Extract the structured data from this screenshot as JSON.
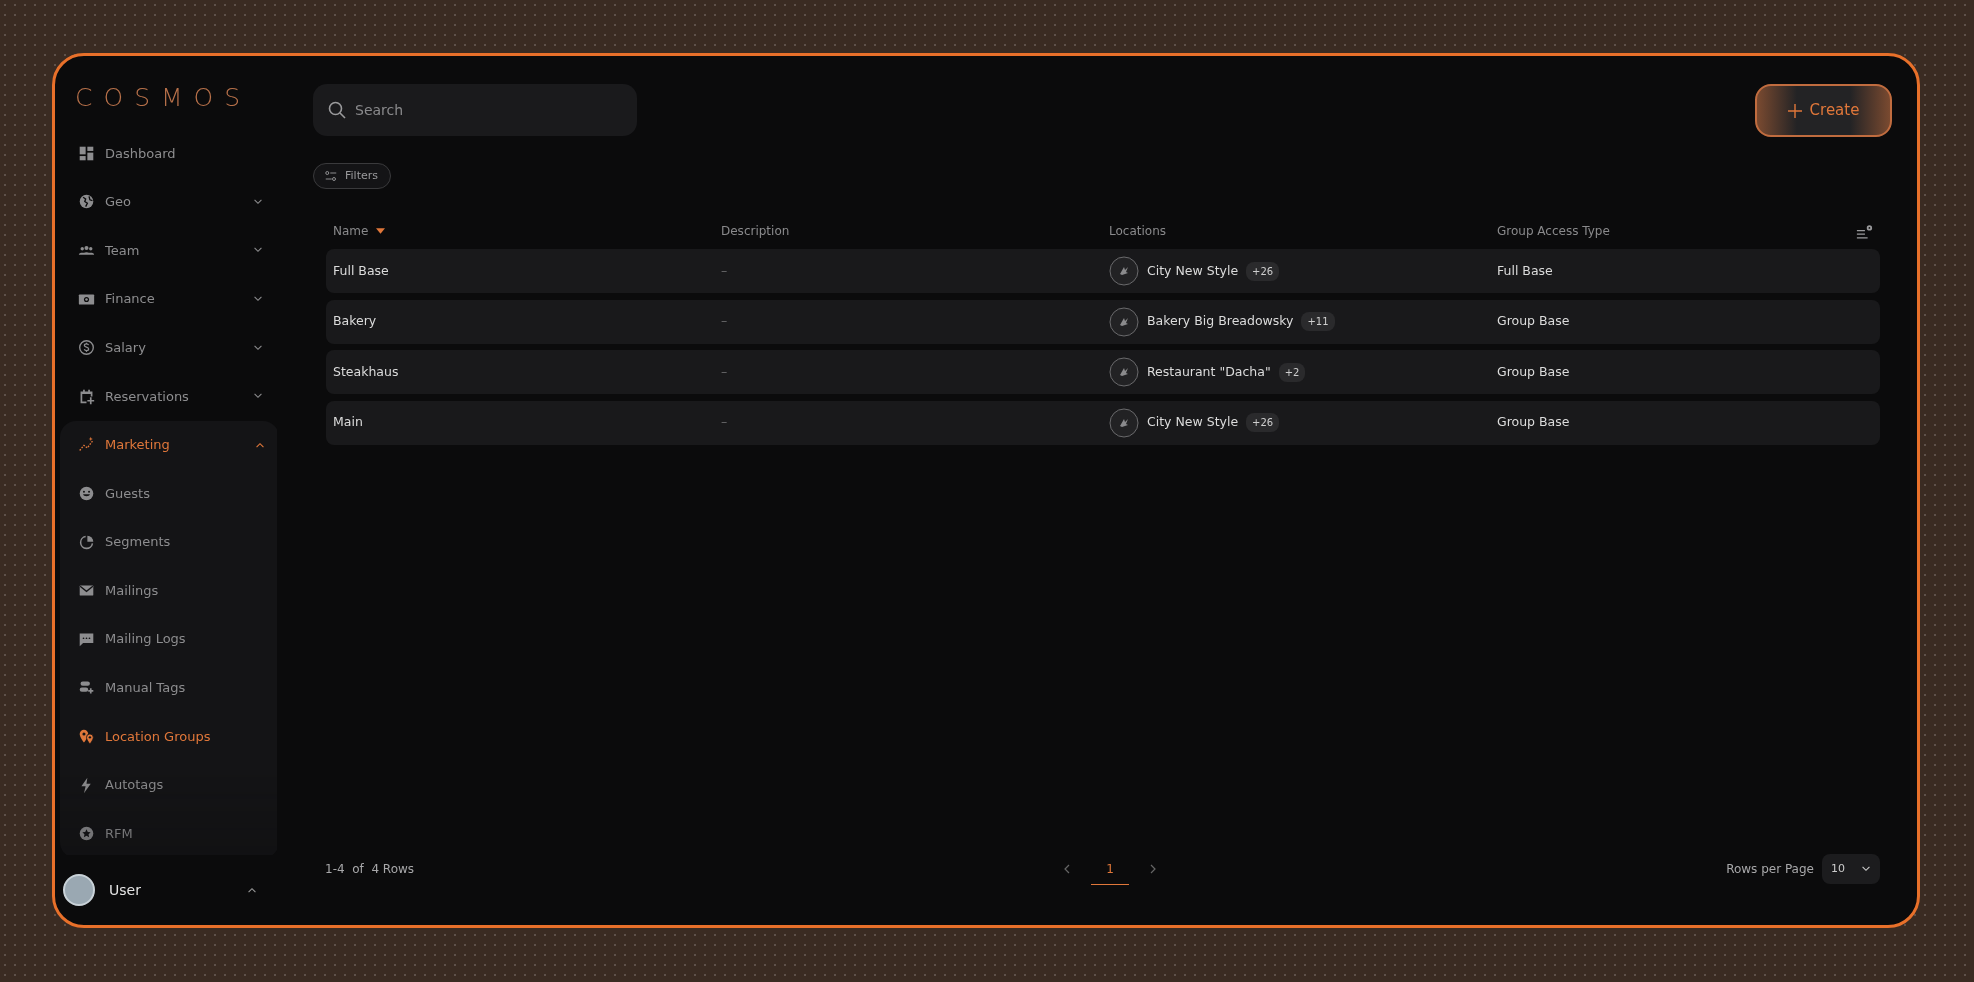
{
  "logo": "COSMOS",
  "sidebar": {
    "items": [
      {
        "label": "Dashboard",
        "selected": false
      },
      {
        "label": "Geo",
        "selected": false,
        "expanded": false
      },
      {
        "label": "Team",
        "selected": false,
        "expanded": false
      },
      {
        "label": "Finance",
        "selected": false,
        "expanded": false
      },
      {
        "label": "Salary",
        "selected": false,
        "expanded": false
      },
      {
        "label": "Reservations",
        "selected": false,
        "expanded": false
      },
      {
        "label": "Marketing",
        "selected": true,
        "expanded": true,
        "children": [
          {
            "label": "Guests",
            "selected": false
          },
          {
            "label": "Segments",
            "selected": false
          },
          {
            "label": "Mailings",
            "selected": false
          },
          {
            "label": "Mailing Logs",
            "selected": false
          },
          {
            "label": "Manual Tags",
            "selected": false
          },
          {
            "label": "Location Groups",
            "selected": true
          },
          {
            "label": "Autotags",
            "selected": false
          },
          {
            "label": "RFM",
            "selected": false
          }
        ]
      }
    ],
    "user": {
      "name": "User",
      "expanded": true
    }
  },
  "search": {
    "placeholder": "Search"
  },
  "create_button": "Create",
  "filters_button": "Filters",
  "table": {
    "columns": [
      {
        "label": "Name",
        "sorted": true
      },
      {
        "label": "Description",
        "sorted": false
      },
      {
        "label": "Locations",
        "sorted": false
      },
      {
        "label": "Group Access Type",
        "sorted": false
      }
    ],
    "rows": [
      {
        "name": "Full Base",
        "description": "–",
        "location": "City New Style",
        "more": "+26",
        "access": "Full Base"
      },
      {
        "name": "Bakery",
        "description": "–",
        "location": "Bakery Big Breadowsky",
        "more": "+11",
        "access": "Group Base"
      },
      {
        "name": "Steakhaus",
        "description": "–",
        "location": "Restaurant \"Dacha\"",
        "more": "+2",
        "access": "Group Base"
      },
      {
        "name": "Main",
        "description": "–",
        "location": "City New Style",
        "more": "+26",
        "access": "Group Base"
      }
    ]
  },
  "footer": {
    "range": "1-4  of  4 Rows",
    "pages": [
      {
        "label": "1",
        "selected": true
      }
    ],
    "rows_per_page_label": "Rows per Page",
    "rows_per_page": "10"
  }
}
